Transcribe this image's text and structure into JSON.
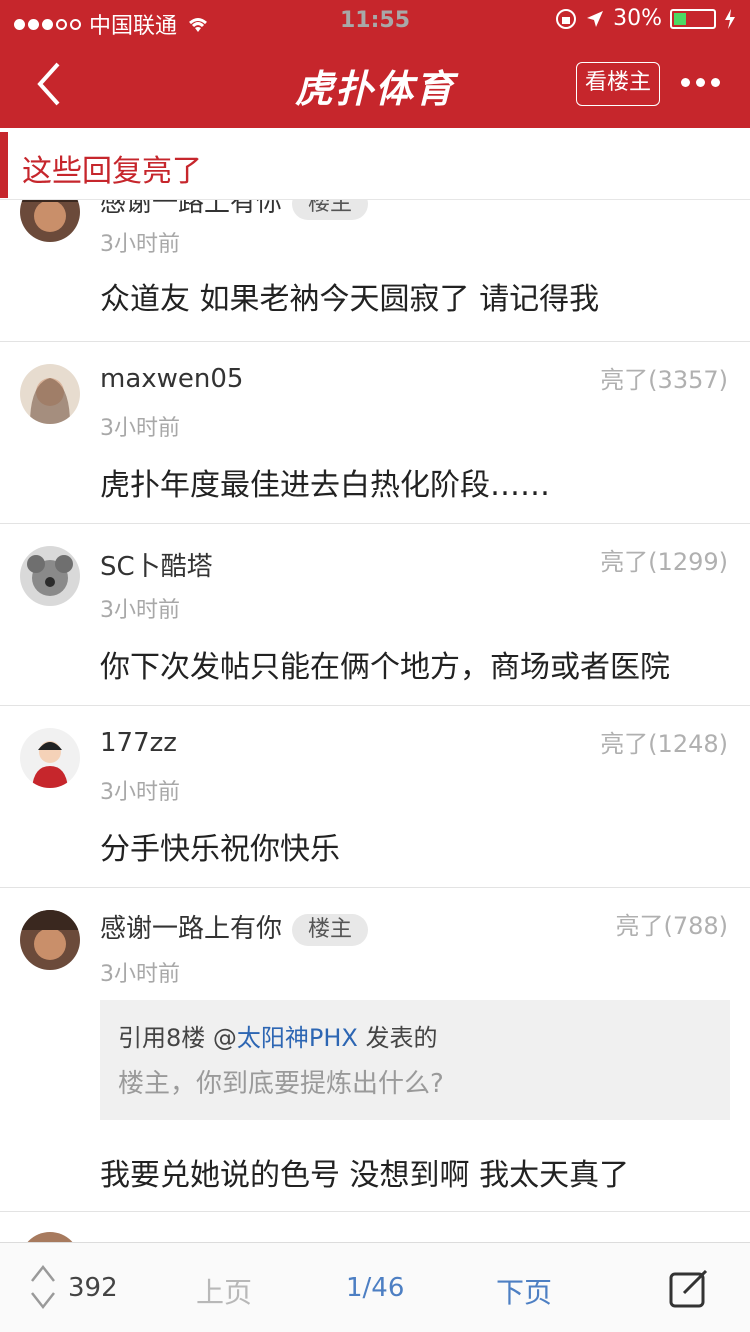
{
  "status": {
    "carrier": "中国联通",
    "time": "11:55",
    "battery": "30%"
  },
  "nav": {
    "logo": "虎扑体育",
    "op_button": "看楼主"
  },
  "section_title": "这些回复亮了",
  "replies": [
    {
      "username": "感谢一路上有你",
      "badge": "楼主",
      "time": "3小时前",
      "text": "众道友 如果老衲今天圆寂了 请记得我"
    },
    {
      "username": "maxwen05",
      "lights": "亮了(3357)",
      "time": "3小时前",
      "text": "虎扑年度最佳进去白热化阶段……"
    },
    {
      "username": "SC卜酷塔",
      "lights": "亮了(1299)",
      "time": "3小时前",
      "text": "你下次发帖只能在俩个地方，商场或者医院"
    },
    {
      "username": "177zz",
      "lights": "亮了(1248)",
      "time": "3小时前",
      "text": "分手快乐祝你快乐"
    },
    {
      "username": "感谢一路上有你",
      "badge": "楼主",
      "lights": "亮了(788)",
      "time": "3小时前",
      "quote": {
        "prefix": "引用8楼 @",
        "user": "太阳神PHX",
        "suffix": " 发表的",
        "text": "楼主，你到底要提炼出什么?"
      },
      "text": "我要兑她说的色号 没想到啊 我太天真了"
    }
  ],
  "bottom": {
    "count": "392",
    "prev": "上页",
    "page": "1/46",
    "next": "下页"
  }
}
